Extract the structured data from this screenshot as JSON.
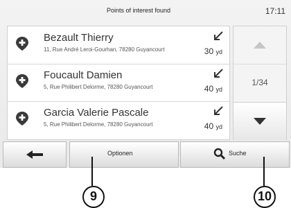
{
  "header": {
    "title": "Points of interest found",
    "clock": "17:11"
  },
  "results": [
    {
      "name": "Bezault Thierry",
      "address": "11, Rue André Leroi-Gourhan, 78280 Guyancourt",
      "distance": "30",
      "unit": "yd"
    },
    {
      "name": "Foucault Damien",
      "address": "5, Rue Philibert Delorme, 78280 Guyancourt",
      "distance": "40",
      "unit": "yd"
    },
    {
      "name": "Garcia Valerie Pascale",
      "address": "5, Rue Philibert Delorme, 78280 Guyancourt",
      "distance": "40",
      "unit": "yd"
    }
  ],
  "scroll": {
    "page_indicator": "1/34"
  },
  "toolbar": {
    "options_label": "Optionen",
    "search_label": "Suche"
  },
  "callouts": {
    "options": "9",
    "search": "10"
  },
  "colors": {
    "background": "#f3f3f3",
    "list_background": "#ffffff",
    "icon_dark": "#333333",
    "callout": "#111111"
  }
}
